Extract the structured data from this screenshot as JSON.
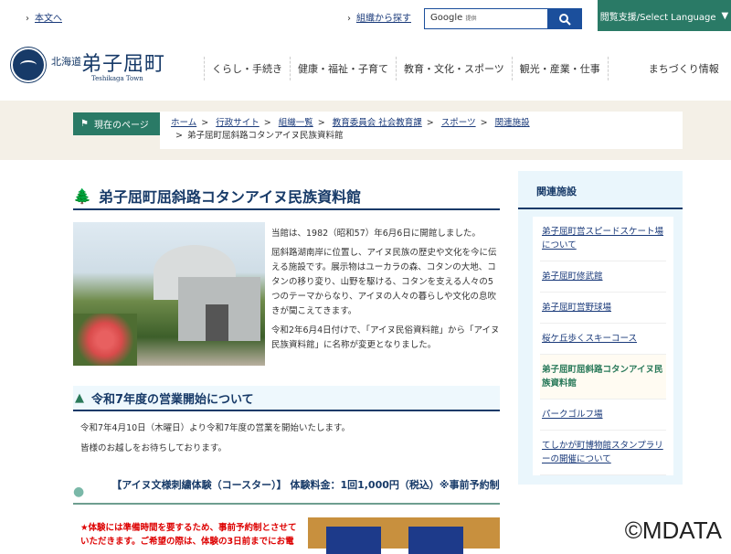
{
  "topbar": {
    "skip_link": "本文へ",
    "org_link": "組織から探す",
    "search_brand": "Google",
    "search_provided": "提供",
    "lang_button": "閲覧支援/Select Language"
  },
  "logo": {
    "prefecture": "北海道",
    "town": "弟子屈町",
    "english": "Teshikaga Town"
  },
  "nav": [
    "くらし・手続き",
    "健康・福祉・子育て",
    "教育・文化・スポーツ",
    "観光・産業・仕事",
    "まちづくり情報"
  ],
  "breadcrumb": {
    "label": "現在のページ",
    "items": [
      "ホーム",
      "行政サイト",
      "組織一覧",
      "教育委員会 社会教育課",
      "スポーツ",
      "関連施設"
    ],
    "current": "弟子屈町屈斜路コタンアイヌ民族資料館"
  },
  "main": {
    "title": "弟子屈町屈斜路コタンアイヌ民族資料館",
    "intro": [
      "当館は、1982（昭和57）年6月6日に開館しました。",
      "屈斜路湖南岸に位置し、アイヌ民族の歴史や文化を今に伝える施設です。展示物はユーカラの森、コタンの大地、コタンの移り変り、山野を駆ける、コタンを支える人々の5つのテーマからなり、アイヌの人々の暮らしや文化の息吹きが聞こえてきます。",
      "令和2年6月4日付けで、「アイヌ民俗資料館」から「アイヌ民族資料館」に名称が変更となりました。"
    ],
    "section1": {
      "heading": "令和7年度の営業開始について",
      "lines": [
        "令和7年4月10日（木曜日）より令和7年度の営業を開始いたします。",
        "皆様のお越しをお待ちしております。"
      ]
    },
    "section2": {
      "heading": "【アイヌ文様刺繍体験（コースター）】 体験料金：1回1,000円（税込）※事前予約制",
      "notice": "★体験には準備時間を要するため、事前予約制とさせていただきます。ご希望の際は、体験の3日前までにお電"
    }
  },
  "sidebar": {
    "heading": "関連施設",
    "items": [
      "弟子屈町営スピードスケート場について",
      "弟子屈町修武館",
      "弟子屈町営野球場",
      "桜ケ丘歩くスキーコース",
      "弟子屈町屈斜路コタンアイヌ民族資料館",
      "パークゴルフ場",
      "てしかが町博物館スタンプラリーの開催について"
    ],
    "current_index": 4
  },
  "watermark": "©MDATA"
}
